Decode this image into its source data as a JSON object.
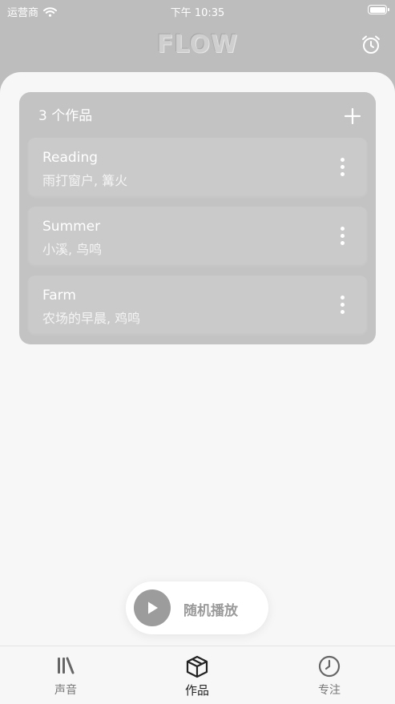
{
  "status_bar": {
    "carrier": "运营商",
    "time": "下午 10:35"
  },
  "header": {
    "logo": "FLOW"
  },
  "works": {
    "count_label": "3 个作品",
    "items": [
      {
        "title": "Reading",
        "subtitle": "雨打窗户, 篝火"
      },
      {
        "title": "Summer",
        "subtitle": "小溪, 鸟鸣"
      },
      {
        "title": "Farm",
        "subtitle": "农场的早晨, 鸡鸣"
      }
    ]
  },
  "shuffle": {
    "label": "随机播放"
  },
  "tabs": [
    {
      "label": "声音",
      "icon": "library-icon"
    },
    {
      "label": "作品",
      "icon": "cube-icon"
    },
    {
      "label": "专注",
      "icon": "clock-icon"
    }
  ],
  "colors": {
    "header_bg": "#bdbdbd",
    "card_bg": "#c3c3c3",
    "sheet_bg": "#f7f7f7",
    "accent_gray": "#9c9c9c"
  }
}
